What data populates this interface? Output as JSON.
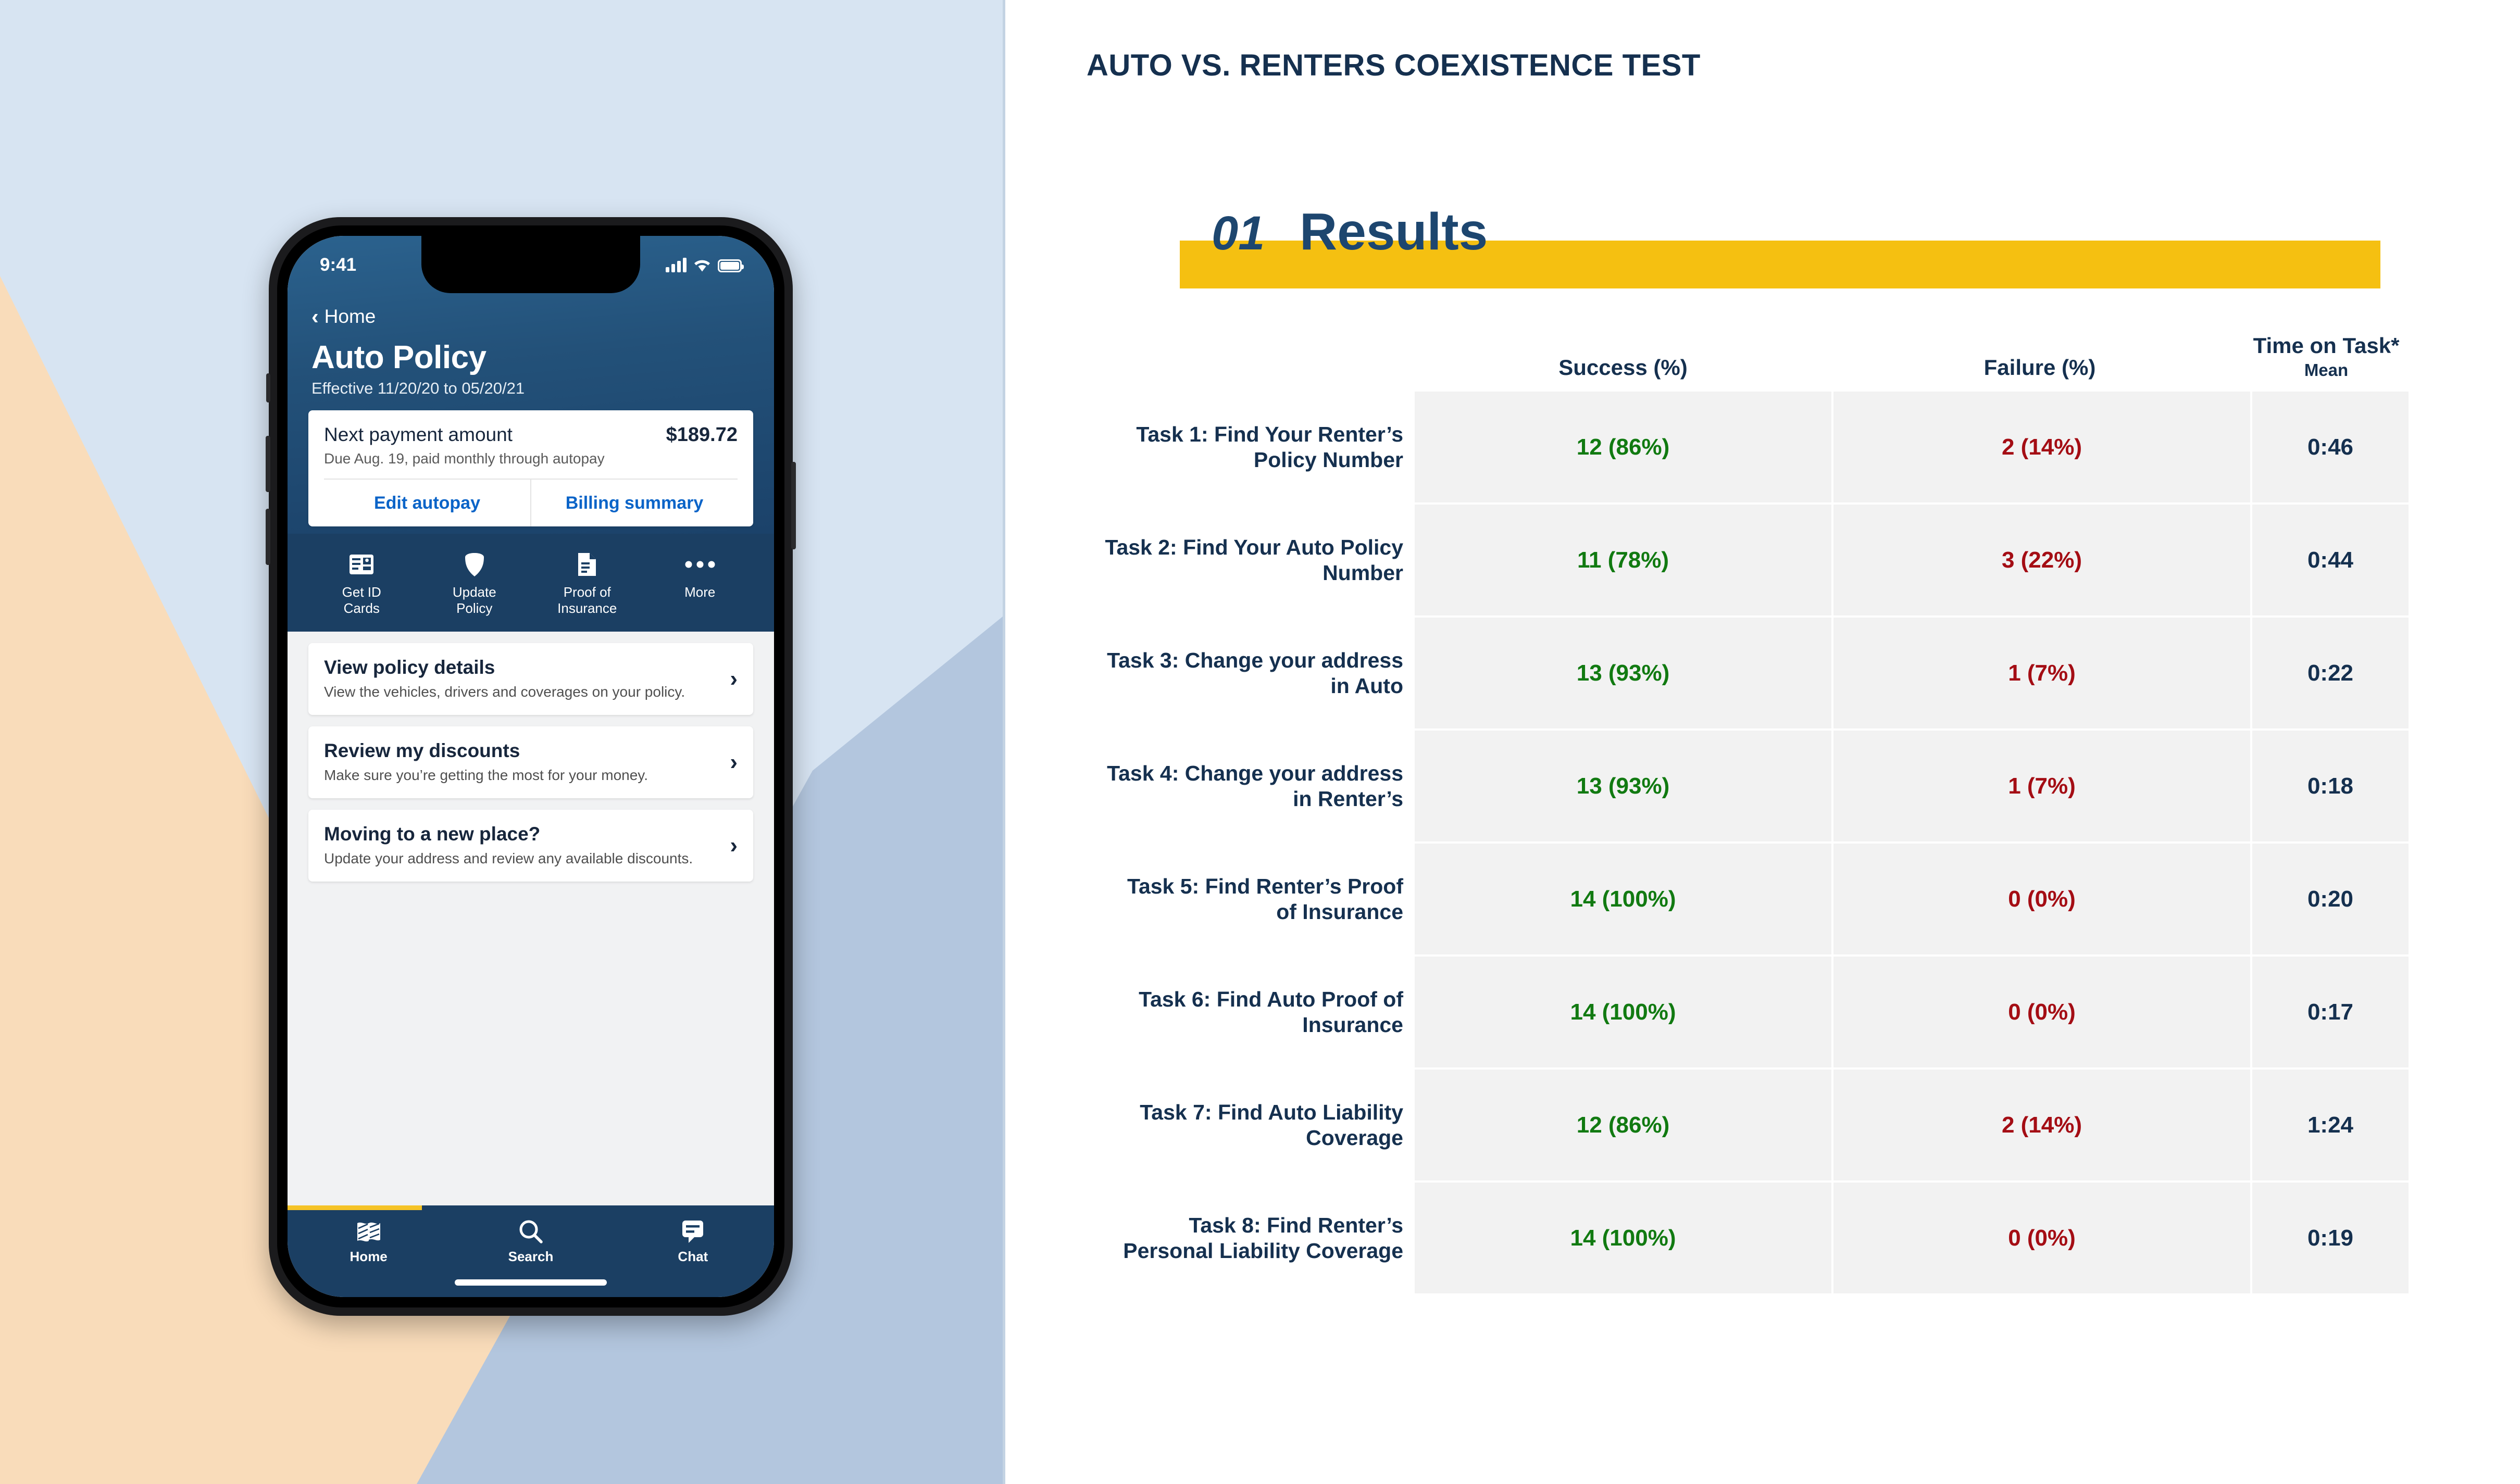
{
  "left_panel": {
    "phone": {
      "status_bar": {
        "time": "9:41",
        "signal_icon": "cellular-signal-icon",
        "wifi_icon": "wifi-icon",
        "battery_icon": "battery-icon"
      },
      "header": {
        "back_label": "Home",
        "back_icon": "chevron-left-icon",
        "title": "Auto Policy",
        "effective": "Effective 11/20/20 to 05/20/21"
      },
      "payment_card": {
        "label": "Next payment amount",
        "amount": "$189.72",
        "sub": "Due Aug. 19, paid monthly through autopay",
        "actions": [
          "Edit autopay",
          "Billing summary"
        ]
      },
      "quick_actions": [
        {
          "label": "Get ID\nCards",
          "icon": "id-card-icon"
        },
        {
          "label": "Update\nPolicy",
          "icon": "shield-icon"
        },
        {
          "label": "Proof of\nInsurance",
          "icon": "document-icon"
        },
        {
          "label": "More",
          "icon": "ellipsis-icon"
        }
      ],
      "cards": [
        {
          "title": "View policy details",
          "desc": "View the vehicles, drivers and coverages on your policy.",
          "chevron": "›"
        },
        {
          "title": "Review my discounts",
          "desc": "Make sure you’re getting the most for your money.",
          "chevron": "›"
        },
        {
          "title": "Moving to a new place?",
          "desc": "Update your address and review any available discounts.",
          "chevron": "›"
        }
      ],
      "tabs": [
        {
          "label": "Home",
          "icon": "flag-home-icon"
        },
        {
          "label": "Search",
          "icon": "search-icon"
        },
        {
          "label": "Chat",
          "icon": "chat-bubble-icon"
        }
      ]
    },
    "colors": {
      "background": "#d7e4f2",
      "peach_shape": "#f9dcba",
      "slate_shape": "#b3c6de",
      "app_navy": "#1b3f63",
      "app_header_blue": "#235179",
      "link_blue": "#0a64c8",
      "accent_yellow": "#f5c326"
    }
  },
  "right_panel": {
    "deck_title": "AUTO VS. RENTERS COEXISTENCE TEST",
    "section": {
      "number": "01",
      "name": "Results",
      "bar_color": "#f5c011",
      "text_color": "#1d466f"
    },
    "colors": {
      "navy": "#15304f",
      "success_green": "#117a11",
      "failure_red": "#a40d14",
      "cell_gray": "#f2f2f2"
    }
  },
  "chart_data": {
    "type": "table",
    "title": "01 Results",
    "columns": [
      "",
      "Success  (%)",
      "Failure  (%)",
      "Time on Task*"
    ],
    "column_sub": {
      "time_on_task": "Mean"
    },
    "rows": [
      {
        "task": "Task 1: Find Your Renter’s Policy Number",
        "success": "12 (86%)",
        "failure": "2 (14%)",
        "time": "0:46"
      },
      {
        "task": "Task 2: Find Your Auto Policy Number",
        "success": "11 (78%)",
        "failure": "3 (22%)",
        "time": "0:44"
      },
      {
        "task": "Task 3: Change your address in Auto",
        "success": "13 (93%)",
        "failure": "1 (7%)",
        "time": "0:22"
      },
      {
        "task": "Task 4: Change your address in Renter’s",
        "success": "13 (93%)",
        "failure": "1 (7%)",
        "time": "0:18"
      },
      {
        "task": "Task 5: Find Renter’s Proof of Insurance",
        "success": "14 (100%)",
        "failure": "0 (0%)",
        "time": "0:20"
      },
      {
        "task": "Task 6: Find Auto Proof of Insurance",
        "success": "14 (100%)",
        "failure": "0 (0%)",
        "time": "0:17"
      },
      {
        "task": "Task 7: Find Auto Liability Coverage",
        "success": "12 (86%)",
        "failure": "2 (14%)",
        "time": "1:24"
      },
      {
        "task": "Task 8: Find Renter’s Personal Liability Coverage",
        "success": "14 (100%)",
        "failure": "0 (0%)",
        "time": "0:19"
      }
    ]
  }
}
